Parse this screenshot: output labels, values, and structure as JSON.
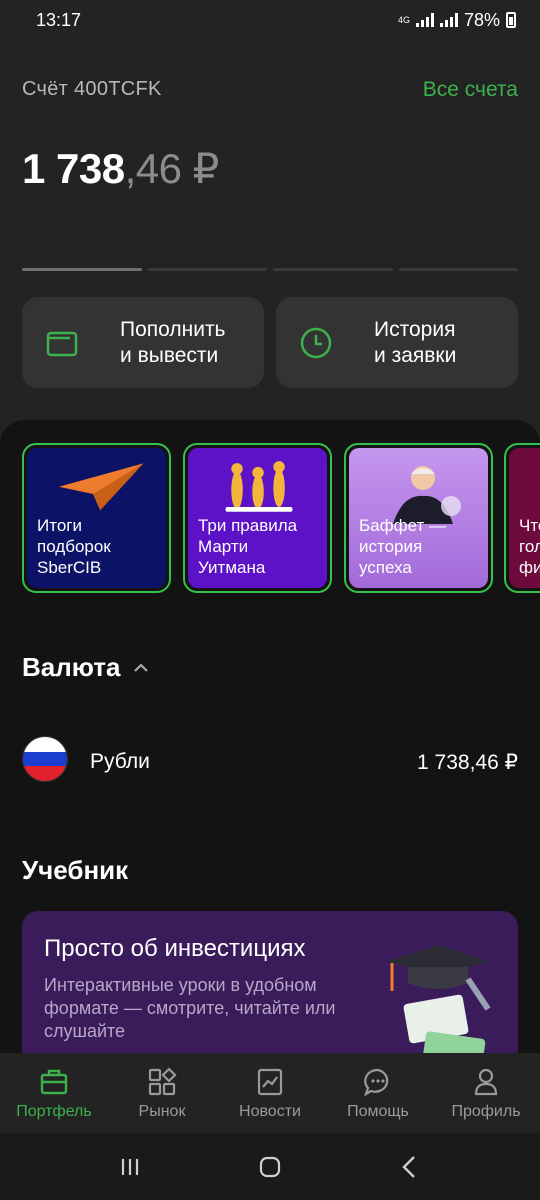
{
  "status": {
    "time": "13:17",
    "network": "4G",
    "battery": "78%"
  },
  "account": {
    "name": "Счёт 400TCFK",
    "all_accounts": "Все счета"
  },
  "balance": {
    "integer": "1 738",
    "fraction": ",46 ₽"
  },
  "actions": [
    {
      "label": "Пополнить\nи вывести",
      "icon": "wallet-icon"
    },
    {
      "label": "История\nи заявки",
      "icon": "clock-icon"
    }
  ],
  "stories": [
    {
      "text": "Итоги\nподборок\nSberCIB"
    },
    {
      "text": "Три правила\nМарти\nУитмана"
    },
    {
      "text": "Баффет —\nистория\nуспеха"
    },
    {
      "text": "Что\nгол\nфи"
    }
  ],
  "currency": {
    "title": "Валюта",
    "items": [
      {
        "name": "Рубли",
        "value": "1 738,46 ₽"
      }
    ]
  },
  "textbook": {
    "title": "Учебник",
    "card_title": "Просто об инвестициях",
    "card_text": "Интерактивные уроки в удобном формате — смотрите, читайте или слушайте"
  },
  "nav": [
    {
      "label": "Портфель",
      "icon": "briefcase-icon",
      "active": true
    },
    {
      "label": "Рынок",
      "icon": "market-icon"
    },
    {
      "label": "Новости",
      "icon": "news-icon"
    },
    {
      "label": "Помощь",
      "icon": "chat-icon"
    },
    {
      "label": "Профиль",
      "icon": "user-icon"
    }
  ],
  "colors": {
    "accent": "#3cb24c",
    "story_border": "#33c24d"
  }
}
